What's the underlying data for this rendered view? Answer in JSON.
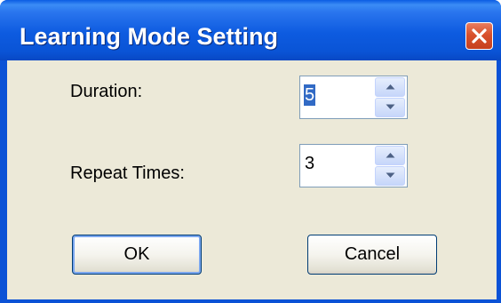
{
  "window": {
    "title": "Learning Mode Setting"
  },
  "titlebar_buttons": {
    "close_icon": "close-icon"
  },
  "fields": {
    "duration": {
      "label": "Duration:",
      "value": "5",
      "selected": true
    },
    "repeat_times": {
      "label": "Repeat Times:",
      "value": "3",
      "selected": false
    }
  },
  "buttons": {
    "ok_label": "OK",
    "cancel_label": "Cancel"
  },
  "colors": {
    "titlebar_blue": "#0a54d6",
    "close_red": "#d9512c",
    "dialog_face": "#ece9d8",
    "selection": "#316ac5"
  }
}
